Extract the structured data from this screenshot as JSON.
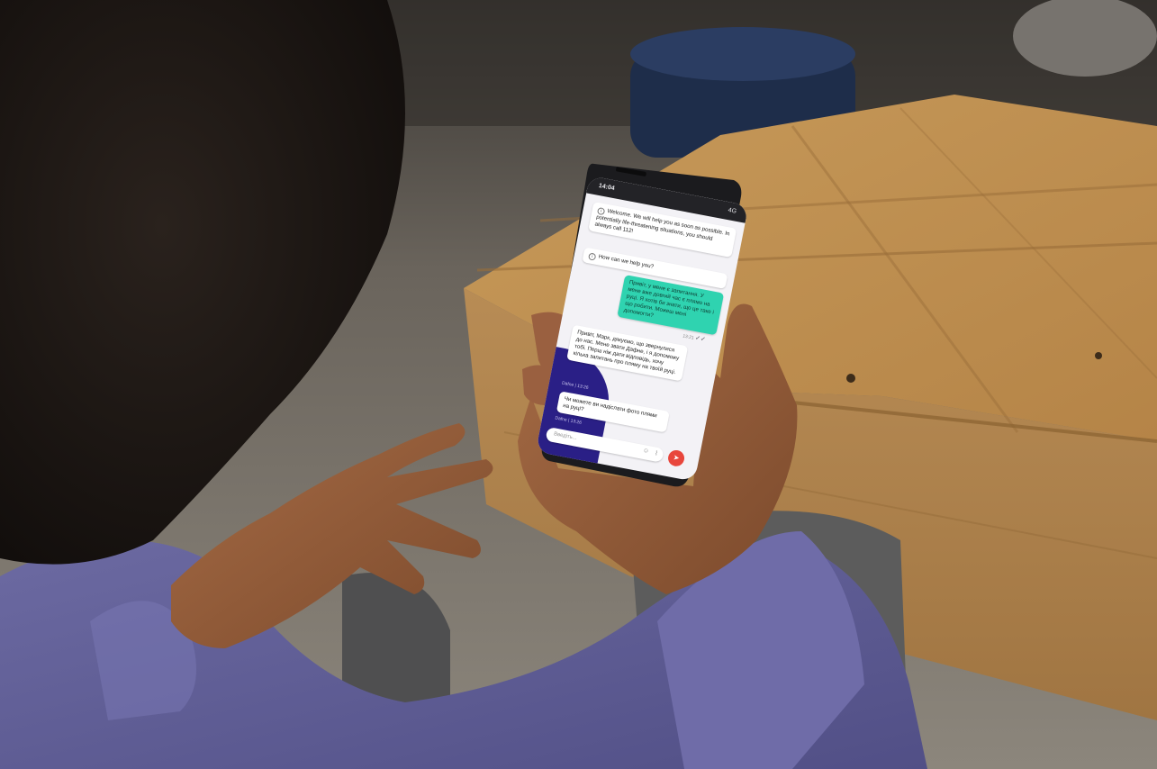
{
  "phone": {
    "status_time": "14:04",
    "status_right": "4G",
    "messages": [
      {
        "role": "bot",
        "text": "Welcome. We will help you as soon as possible. In potentially life-threatening situations, you should always call 112!"
      },
      {
        "role": "bot",
        "text": "How can we help you?"
      },
      {
        "role": "user",
        "text": "Привіт, у мене є запитання. У мене вже довгий час є плямо на руці. Я хотів би знати, що це таке і що робити. Можеш мені допомогти?",
        "time": "13:21"
      },
      {
        "role": "agent",
        "text": "Привіт, Марк, дякуємо, що звернулися до нас. Мене звати Дафне, і я допоможу тобі. Перш ніж дати відповідь, хочу кілька запитань про пляму на твоїй руці.",
        "caption": "Dafne | 13:26"
      },
      {
        "role": "agent",
        "text": "Чи можете ви надіслати фото плями на руці?",
        "caption": "Dafne | 13:26"
      }
    ],
    "input_placeholder": "Введіть...",
    "colors": {
      "user_bubble": "#2fd3b0",
      "accent_blob": "#2a1f86",
      "send_button": "#e8463c"
    },
    "icons": {
      "send": "send-icon",
      "emoji": "emoji-icon",
      "attach": "paperclip-icon",
      "info": "info-icon"
    }
  }
}
